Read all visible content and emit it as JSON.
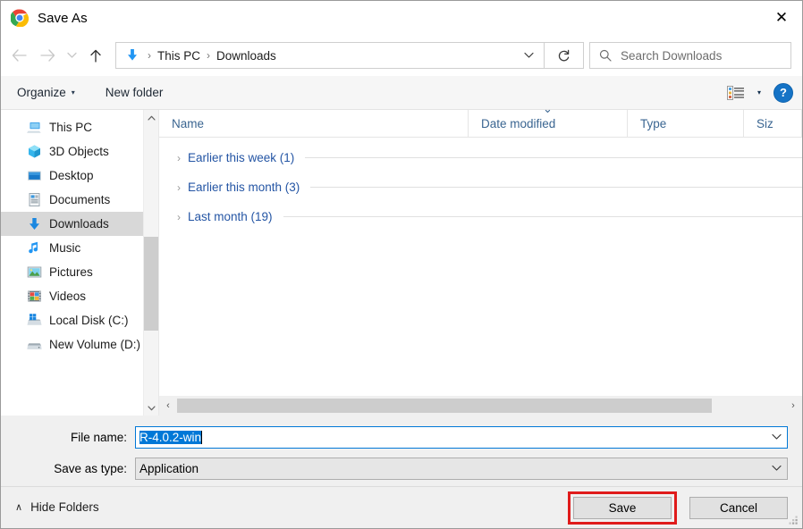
{
  "window": {
    "title": "Save As",
    "app_icon": "chrome-icon",
    "close_label": "✕"
  },
  "nav": {
    "back_icon": "arrow-left-icon",
    "forward_icon": "arrow-right-icon",
    "recent_icon": "chevron-down-icon",
    "up_icon": "arrow-up-icon",
    "address": {
      "location_icon": "downloads-arrow-icon",
      "crumbs": [
        "This PC",
        "Downloads"
      ],
      "separator": "›",
      "dropdown_icon": "chevron-down-icon"
    },
    "refresh_icon": "refresh-icon",
    "search": {
      "icon": "search-icon",
      "placeholder": "Search Downloads",
      "value": ""
    }
  },
  "commandbar": {
    "organize_label": "Organize",
    "organize_caret": "▾",
    "new_folder_label": "New folder",
    "view_icon": "list-view-icon",
    "view_caret": "▾",
    "help_label": "?"
  },
  "sidebar": {
    "items": [
      {
        "label": "This PC",
        "icon": "this-pc-icon",
        "selected": false
      },
      {
        "label": "3D Objects",
        "icon": "3d-objects-icon",
        "selected": false
      },
      {
        "label": "Desktop",
        "icon": "desktop-icon",
        "selected": false
      },
      {
        "label": "Documents",
        "icon": "documents-icon",
        "selected": false
      },
      {
        "label": "Downloads",
        "icon": "downloads-icon",
        "selected": true
      },
      {
        "label": "Music",
        "icon": "music-icon",
        "selected": false
      },
      {
        "label": "Pictures",
        "icon": "pictures-icon",
        "selected": false
      },
      {
        "label": "Videos",
        "icon": "videos-icon",
        "selected": false
      },
      {
        "label": "Local Disk (C:)",
        "icon": "local-disk-icon",
        "selected": false
      },
      {
        "label": "New Volume (D:)",
        "icon": "drive-icon",
        "selected": false
      }
    ],
    "scroll_up_icon": "chevron-up-icon",
    "scroll_down_icon": "chevron-down-icon"
  },
  "filelist": {
    "columns": [
      {
        "label": "Name",
        "sorted": false
      },
      {
        "label": "Date modified",
        "sorted": true
      },
      {
        "label": "Type",
        "sorted": false
      },
      {
        "label": "Siz",
        "sorted": false
      }
    ],
    "groups": [
      {
        "label": "Earlier this week (1)",
        "chevron": "›",
        "expanded": false
      },
      {
        "label": "Earlier this month (3)",
        "chevron": "›",
        "expanded": false
      },
      {
        "label": "Last month (19)",
        "chevron": "›",
        "expanded": false
      }
    ],
    "hscroll": {
      "left_icon": "‹",
      "right_icon": "›"
    }
  },
  "form": {
    "filename_label": "File name:",
    "filename_value": "R-4.0.2-win",
    "filename_selected": true,
    "savetype_label": "Save as type:",
    "savetype_value": "Application",
    "dropdown_icon": "chevron-down-icon"
  },
  "footer": {
    "hide_folders_label": "Hide Folders",
    "hide_folders_chevron": "∧",
    "save_label": "Save",
    "cancel_label": "Cancel",
    "save_highlighted": true,
    "highlight_color": "#e01b1b",
    "resize_grip_icon": "resize-grip-icon"
  },
  "colors": {
    "accent": "#0078d7",
    "selection": "#0078d7",
    "group_text": "#2455a4",
    "column_header_text": "#3a6591",
    "highlight_box": "#e01b1b",
    "sidebar_selected": "#d8d8d8"
  }
}
